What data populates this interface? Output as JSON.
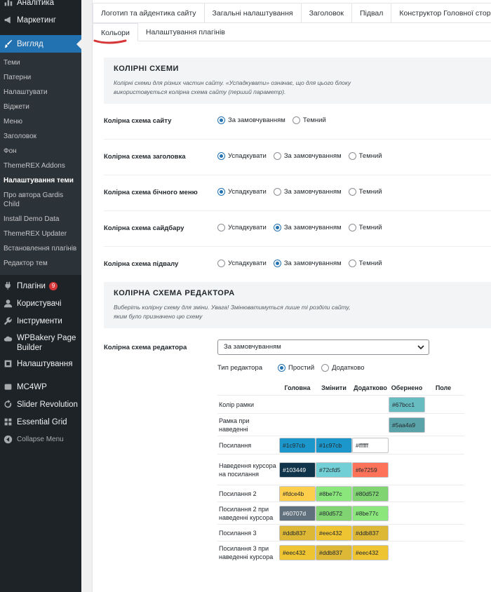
{
  "sidebar": {
    "top_items": [
      {
        "label": "Аналітика"
      },
      {
        "label": "Маркетинг"
      },
      {
        "label": "Вигляд"
      }
    ],
    "sub_items": [
      {
        "label": "Теми"
      },
      {
        "label": "Патерни"
      },
      {
        "label": "Налаштувати"
      },
      {
        "label": "Віджети"
      },
      {
        "label": "Меню"
      },
      {
        "label": "Заголовок"
      },
      {
        "label": "Фон"
      },
      {
        "label": "ThemeREX Addons"
      },
      {
        "label": "Налаштування теми"
      },
      {
        "label": "Про автора Gardis Child"
      },
      {
        "label": "Install Demo Data"
      },
      {
        "label": "ThemeREX Updater"
      },
      {
        "label": "Встановлення плагінів"
      },
      {
        "label": "Редактор тем"
      }
    ],
    "bottom_items": [
      {
        "label": "Плагіни",
        "badge": "9"
      },
      {
        "label": "Користувачі"
      },
      {
        "label": "Інструменти"
      },
      {
        "label": "WPBakery Page Builder"
      },
      {
        "label": "Налаштування"
      },
      {
        "label": "MC4WP"
      },
      {
        "label": "Slider Revolution"
      },
      {
        "label": "Essential Grid"
      },
      {
        "label": "Collapse Menu"
      }
    ]
  },
  "tabs": {
    "row1": [
      "Логотип та айдентика сайту",
      "Загальні налаштування",
      "Заголовок",
      "Підвал",
      "Конструктор Головної сторінки"
    ],
    "row2": [
      "Кольори",
      "Налаштування плагінів"
    ]
  },
  "schemes": {
    "title": "КОЛІРНІ СХЕМИ",
    "desc": "Колірні схеми для різних частин сайту. «Успадкувати» означає, що для цього блоку використовується колірна схема сайту (перший параметр).",
    "rows": [
      {
        "label": "Колірна схема сайту",
        "options": [
          "За замовчуванням",
          "Темний"
        ],
        "selected": 0
      },
      {
        "label": "Колірна схема заголовка",
        "options": [
          "Успадкувати",
          "За замовчуванням",
          "Темний"
        ],
        "selected": 0
      },
      {
        "label": "Колірна схема бічного меню",
        "options": [
          "Успадкувати",
          "За замовчуванням",
          "Темний"
        ],
        "selected": 0
      },
      {
        "label": "Колірна схема сайдбару",
        "options": [
          "Успадкувати",
          "За замовчуванням",
          "Темний"
        ],
        "selected": 1
      },
      {
        "label": "Колірна схема підвалу",
        "options": [
          "Успадкувати",
          "За замовчуванням",
          "Темний"
        ],
        "selected": 1
      }
    ]
  },
  "editor": {
    "title": "КОЛІРНА СХЕМА РЕДАКТОРА",
    "desc": "Виберіть колірну схему для зміни. Увага! Змінюватимуться лише ті розділи сайту, яким було призначено цю схему",
    "label": "Колірна схема редактора",
    "select_value": "За замовчуванням",
    "type_label": "Тип редактора",
    "type_options": [
      "Простий",
      "Додатково"
    ],
    "type_selected": 0,
    "columns": [
      "Головна",
      "Змінити",
      "Додатково",
      "Обернено",
      "Поле"
    ],
    "rows": [
      {
        "label": "Колір рамки",
        "cells": [
          "",
          "",
          "",
          "#67bcc1",
          ""
        ]
      },
      {
        "label": "Рамка при наведенні",
        "cells": [
          "",
          "",
          "",
          "#5aa4a9",
          ""
        ]
      },
      {
        "label": "Посилання",
        "cells": [
          "#1c97cb",
          "#1c97cb",
          "#ffffff",
          "",
          ""
        ]
      },
      {
        "label": "Наведення курсора на посилання",
        "cells": [
          "#103449",
          "#72cfd5",
          "#fe7259",
          "",
          ""
        ]
      },
      {
        "label": "Посилання 2",
        "cells": [
          "#fdce4b",
          "#8be77c",
          "#80d572",
          "",
          ""
        ]
      },
      {
        "label": "Посилання 2 при наведенні курсора",
        "cells": [
          "#60707d",
          "#80d572",
          "#8be77c",
          "",
          ""
        ]
      },
      {
        "label": "Посилання 3",
        "cells": [
          "#ddb837",
          "#eec432",
          "#ddb837",
          "",
          ""
        ]
      },
      {
        "label": "Посилання 3 при наведенні курсора",
        "cells": [
          "#eec432",
          "#ddb837",
          "#eec432",
          "",
          ""
        ]
      }
    ]
  },
  "colors": {
    "sidebar_bg": "#1d2327",
    "accent": "#2271b1",
    "underline": "#d63638"
  }
}
